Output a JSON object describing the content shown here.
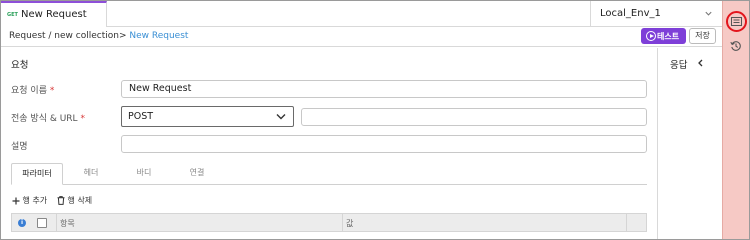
{
  "tabs": [
    {
      "method": "GET",
      "title": "New Request"
    }
  ],
  "environment": {
    "selected": "Local_Env_1"
  },
  "breadcrumb": {
    "path": "Request / new collection>",
    "current": "New Request"
  },
  "toolbar": {
    "test_label": "테스트",
    "save_label": "저장"
  },
  "request": {
    "section_title": "요청",
    "name_label": "요청 이름",
    "name_required": "*",
    "name_value": "New Request",
    "method_url_label": "전송 방식 & URL",
    "method_url_required": "*",
    "method_value": "POST",
    "url_value": "",
    "description_label": "설명",
    "description_value": ""
  },
  "subtabs": [
    "파라미터",
    "헤더",
    "바디",
    "연결"
  ],
  "row_actions": {
    "add_label": "행 추가",
    "delete_label": "행 삭제"
  },
  "table": {
    "info_icon": "i",
    "columns": [
      "항목",
      "값"
    ]
  },
  "response": {
    "label": "응답"
  },
  "rail": {
    "icons": [
      "panel-toggle-icon",
      "history-icon"
    ],
    "highlight_color": "#e3141c"
  },
  "colors": {
    "accent": "#7e3fd8",
    "link": "#3a8fd4",
    "rail_bg": "#f6c9c5"
  }
}
